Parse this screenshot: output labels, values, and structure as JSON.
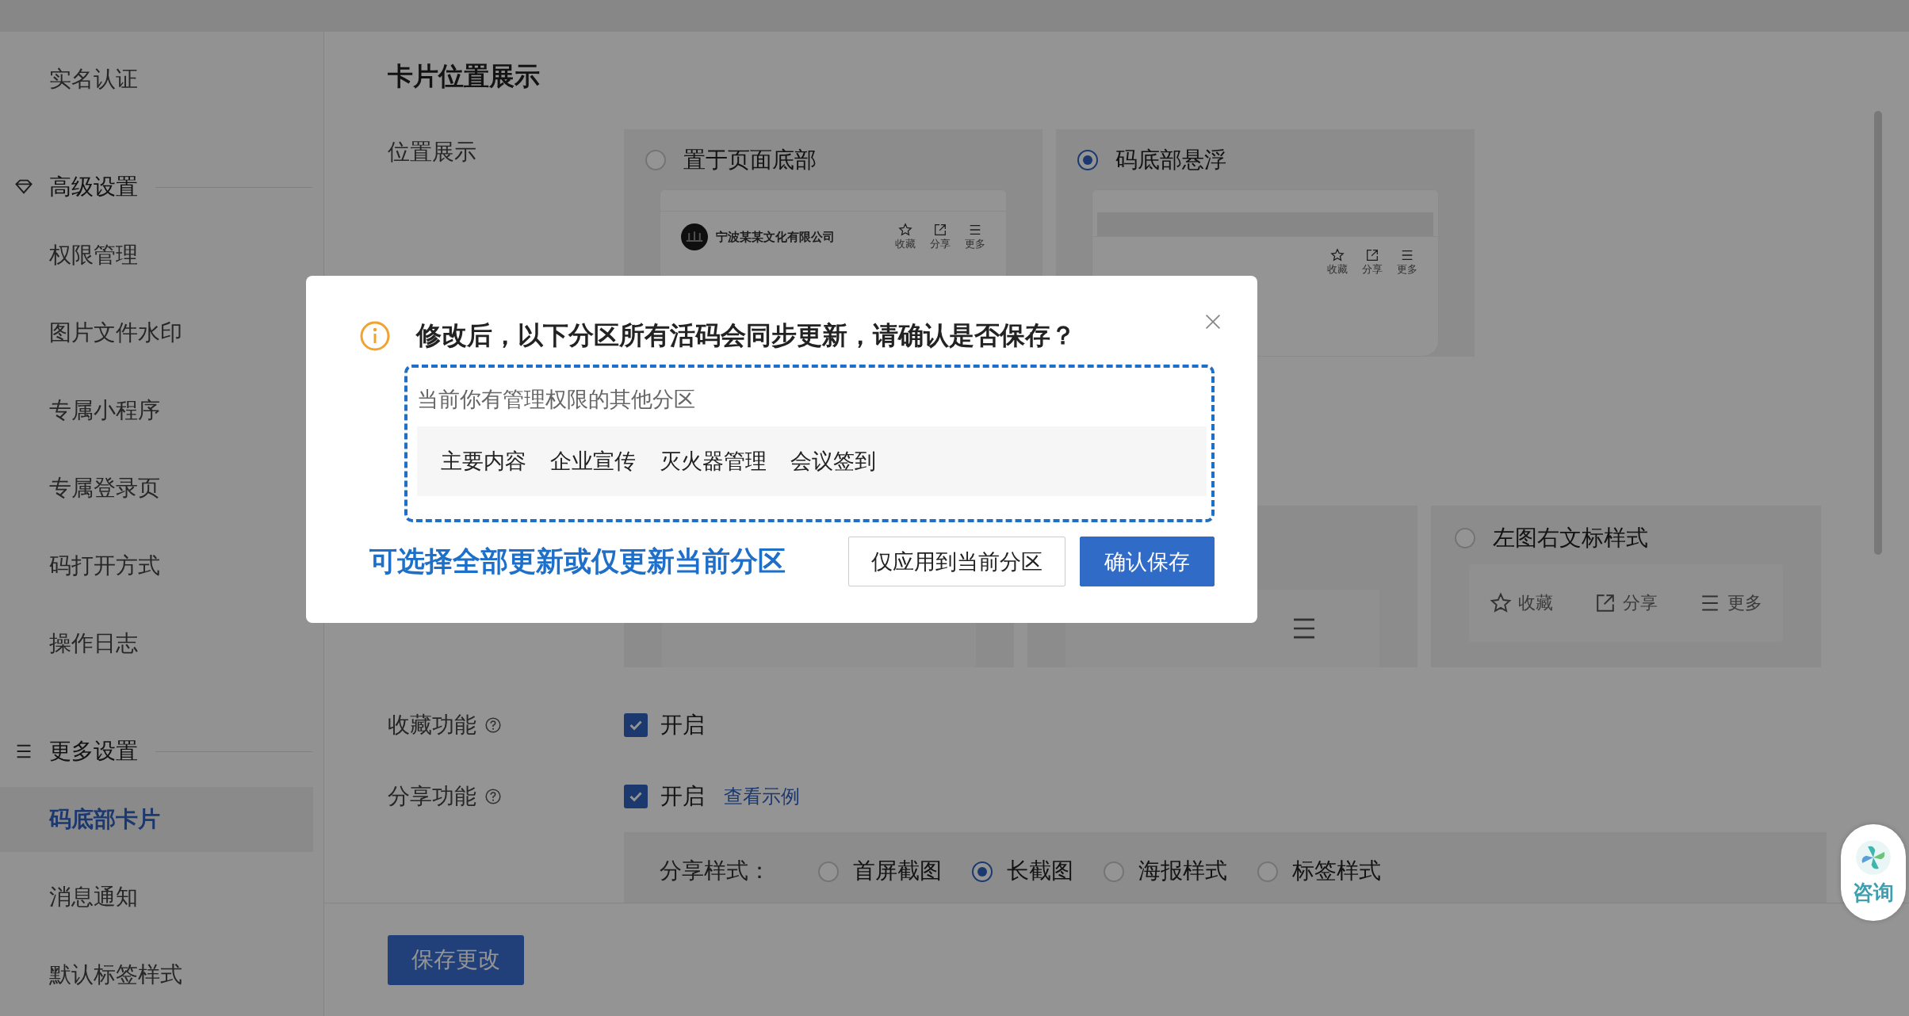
{
  "sidebar": {
    "groups": [
      {
        "items": [
          {
            "label": "实名认证",
            "selected": false
          }
        ]
      },
      {
        "title": "高级设置",
        "items": [
          {
            "label": "权限管理",
            "selected": false
          },
          {
            "label": "图片文件水印",
            "selected": false
          },
          {
            "label": "专属小程序",
            "selected": false
          },
          {
            "label": "专属登录页",
            "selected": false
          },
          {
            "label": "码打开方式",
            "selected": false
          },
          {
            "label": "操作日志",
            "selected": false
          }
        ]
      },
      {
        "title": "更多设置",
        "items": [
          {
            "label": "码底部卡片",
            "selected": true
          },
          {
            "label": "消息通知",
            "selected": false
          },
          {
            "label": "默认标签样式",
            "selected": false
          }
        ]
      }
    ]
  },
  "section_title": "卡片位置展示",
  "position": {
    "label": "位置展示",
    "options": [
      {
        "label": "置于页面底部",
        "selected": false,
        "company": "宁波某某文化有限公司",
        "actions": [
          "收藏",
          "分享",
          "更多"
        ]
      },
      {
        "label": "码底部悬浮",
        "selected": true,
        "actions": [
          "收藏",
          "分享",
          "更多"
        ]
      }
    ]
  },
  "style_cards": [
    {
      "kind": "blank"
    },
    {
      "kind": "menu-only"
    },
    {
      "kind": "labeled",
      "label": "左图右文标样式",
      "selected": false,
      "actions": [
        "收藏",
        "分享",
        "更多"
      ]
    }
  ],
  "favorite": {
    "label": "收藏功能",
    "checked": true,
    "option": "开启"
  },
  "share": {
    "label": "分享功能",
    "checked": true,
    "option": "开启",
    "link": "查看示例",
    "style_label": "分享样式：",
    "styles": [
      {
        "label": "首屏截图",
        "selected": false
      },
      {
        "label": "长截图",
        "selected": true
      },
      {
        "label": "海报样式",
        "selected": false
      },
      {
        "label": "标签样式",
        "selected": false
      }
    ]
  },
  "save_button": "保存更改",
  "consult": "咨询",
  "dialog": {
    "title": "修改后，以下分区所有活码会同步更新，请确认是否保存？",
    "box_caption": "当前你有管理权限的其他分区",
    "partitions": [
      "主要内容",
      "企业宣传",
      "灭火器管理",
      "会议签到"
    ],
    "hint": "可选择全部更新或仅更新当前分区",
    "buttons": [
      {
        "label": "仅应用到当前分区",
        "kind": "default"
      },
      {
        "label": "确认保存",
        "kind": "primary"
      }
    ]
  }
}
